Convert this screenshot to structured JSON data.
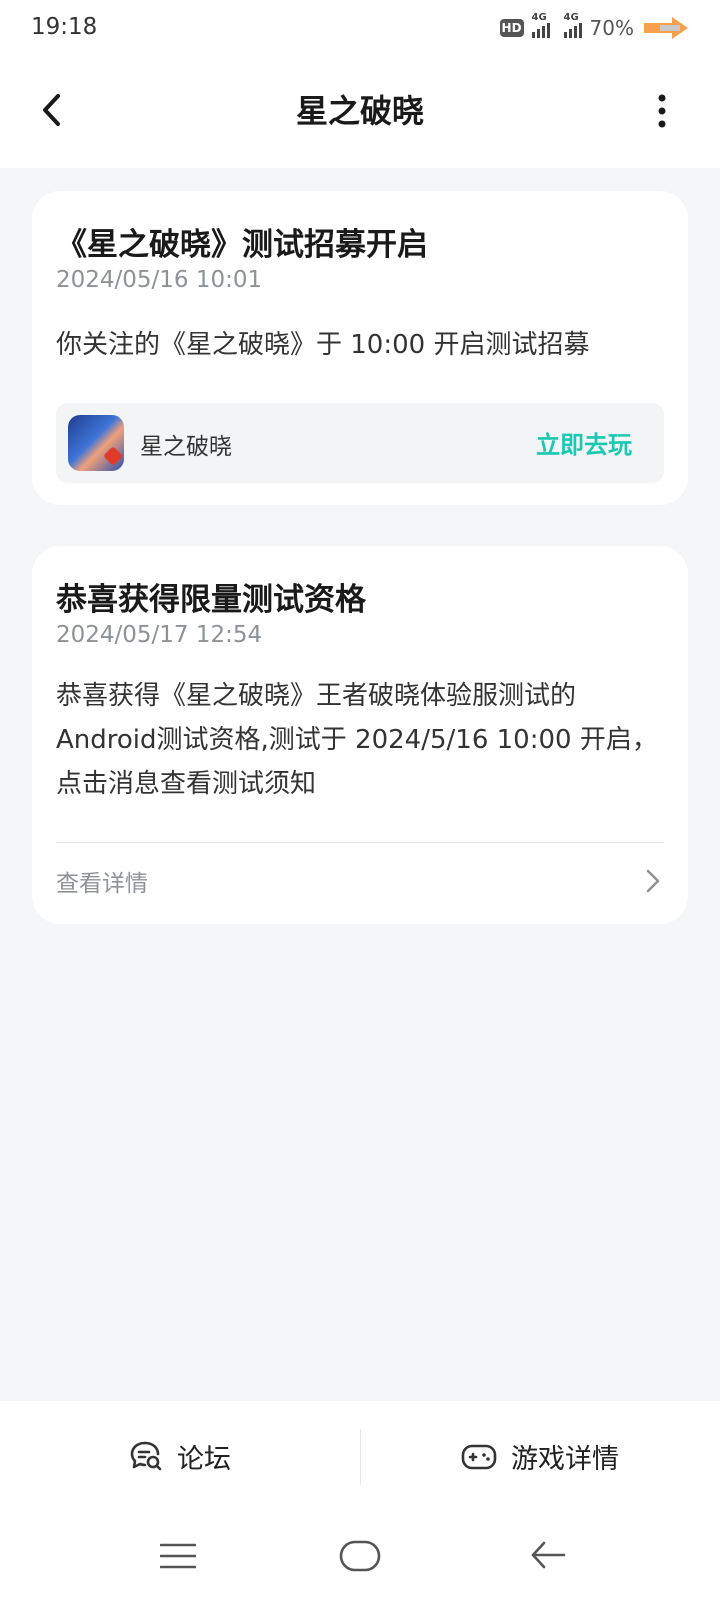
{
  "status_bar": {
    "time": "19:18",
    "hd_label": "HD",
    "network_1": "4G",
    "network_2": "4G",
    "battery": "70%",
    "battery_color": "#f5a04a"
  },
  "header": {
    "title": "星之破晓",
    "back_icon": "chevron-left-icon",
    "more_icon": "more-vertical-icon"
  },
  "messages": [
    {
      "title": "《星之破晓》测试招募开启",
      "time": "2024/05/16 10:01",
      "body": "你关注的《星之破晓》于 10:00 开启测试招募",
      "game": {
        "name": "星之破晓",
        "action": "立即去玩"
      }
    },
    {
      "title": "恭喜获得限量测试资格",
      "time": "2024/05/17 12:54",
      "body": "恭喜获得《星之破晓》王者破晓体验服测试的Android测试资格,测试于 2024/5/16 10:00 开启，点击消息查看测试须知",
      "link": "查看详情"
    }
  ],
  "bottom_actions": {
    "forum": "论坛",
    "game_details": "游戏详情"
  },
  "colors": {
    "accent": "#1bc8b3",
    "background": "#f5f6f8",
    "card": "#ffffff"
  }
}
